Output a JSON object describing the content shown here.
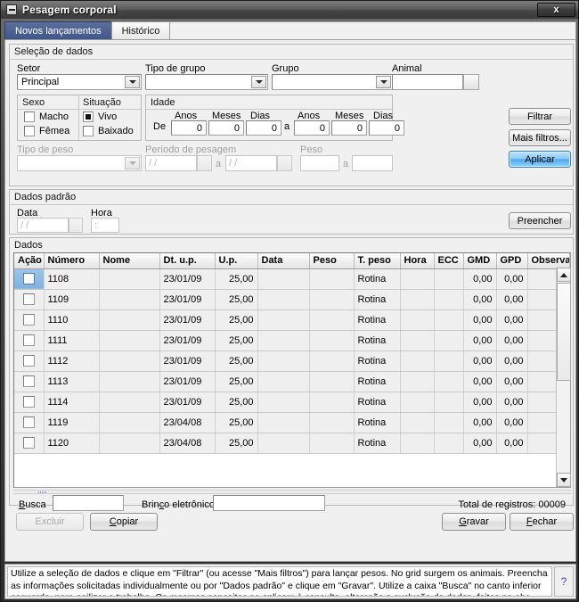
{
  "window": {
    "title": "Pesagem corporal",
    "sysmenu_icon": "minimize-box-icon",
    "close_label": "x"
  },
  "tabs": [
    {
      "label": "Novos lançamentos",
      "active": true
    },
    {
      "label": "Histórico",
      "active": false
    }
  ],
  "selection": {
    "group_label": "Seleção de dados",
    "setor": {
      "label": "Setor",
      "value": "Principal"
    },
    "tipo_de_grupo": {
      "label": "Tipo de grupo",
      "value": ""
    },
    "grupo": {
      "label": "Grupo",
      "value": ""
    },
    "animal": {
      "label": "Animal",
      "value": ""
    },
    "sexo": {
      "label": "Sexo",
      "options": [
        {
          "label": "Macho",
          "checked": false
        },
        {
          "label": "Fêmea",
          "checked": false
        }
      ]
    },
    "situacao": {
      "label": "Situação",
      "options": [
        {
          "label": "Vivo",
          "checked": true
        },
        {
          "label": "Baixado",
          "checked": false
        }
      ]
    },
    "idade": {
      "label": "Idade",
      "from_label": "De",
      "to_label": "a",
      "col_labels": [
        "Anos",
        "Meses",
        "Dias"
      ],
      "from_values": [
        "0",
        "0",
        "0"
      ],
      "to_values": [
        "0",
        "0",
        "0"
      ]
    },
    "tipo_de_peso": {
      "label": "Tipo de peso",
      "value": "",
      "disabled": true
    },
    "periodo_de_pesagem": {
      "label": "Período de pesagem",
      "from_value": "/  /",
      "to_label": "a",
      "to_value": "/  /",
      "disabled": true
    },
    "peso": {
      "label": "Peso",
      "from_value": "",
      "to_label": "a",
      "to_value": "",
      "disabled": true
    },
    "buttons": {
      "filtrar": "Filtrar",
      "mais_filtros": "Mais filtros...",
      "aplicar": "Aplicar"
    }
  },
  "defaults": {
    "group_label": "Dados padrão",
    "data": {
      "label": "Data",
      "value": "/  /"
    },
    "hora": {
      "label": "Hora",
      "value": ":"
    },
    "preencher": "Preencher"
  },
  "grid": {
    "group_label": "Dados",
    "columns": [
      "Ação",
      "Número",
      "Nome",
      "Dt. u.p.",
      "U.p.",
      "Data",
      "Peso",
      "T. peso",
      "Hora",
      "ECC",
      "GMD",
      "GPD",
      "Observação"
    ],
    "rows": [
      {
        "selected": true,
        "acao": "",
        "numero": "1108",
        "nome": "",
        "dt_up": "23/01/09",
        "up": "25,00",
        "data": "",
        "peso": "",
        "t_peso": "Rotina",
        "hora": "",
        "ecc": "",
        "gmd": "0,00",
        "gpd": "0,00",
        "observacao": ""
      },
      {
        "selected": false,
        "acao": "",
        "numero": "1109",
        "nome": "",
        "dt_up": "23/01/09",
        "up": "25,00",
        "data": "",
        "peso": "",
        "t_peso": "Rotina",
        "hora": "",
        "ecc": "",
        "gmd": "0,00",
        "gpd": "0,00",
        "observacao": ""
      },
      {
        "selected": false,
        "acao": "",
        "numero": "1110",
        "nome": "",
        "dt_up": "23/01/09",
        "up": "25,00",
        "data": "",
        "peso": "",
        "t_peso": "Rotina",
        "hora": "",
        "ecc": "",
        "gmd": "0,00",
        "gpd": "0,00",
        "observacao": ""
      },
      {
        "selected": false,
        "acao": "",
        "numero": "1111",
        "nome": "",
        "dt_up": "23/01/09",
        "up": "25,00",
        "data": "",
        "peso": "",
        "t_peso": "Rotina",
        "hora": "",
        "ecc": "",
        "gmd": "0,00",
        "gpd": "0,00",
        "observacao": ""
      },
      {
        "selected": false,
        "acao": "",
        "numero": "1112",
        "nome": "",
        "dt_up": "23/01/09",
        "up": "25,00",
        "data": "",
        "peso": "",
        "t_peso": "Rotina",
        "hora": "",
        "ecc": "",
        "gmd": "0,00",
        "gpd": "0,00",
        "observacao": ""
      },
      {
        "selected": false,
        "acao": "",
        "numero": "1113",
        "nome": "",
        "dt_up": "23/01/09",
        "up": "25,00",
        "data": "",
        "peso": "",
        "t_peso": "Rotina",
        "hora": "",
        "ecc": "",
        "gmd": "0,00",
        "gpd": "0,00",
        "observacao": ""
      },
      {
        "selected": false,
        "acao": "",
        "numero": "1114",
        "nome": "",
        "dt_up": "23/01/09",
        "up": "25,00",
        "data": "",
        "peso": "",
        "t_peso": "Rotina",
        "hora": "",
        "ecc": "",
        "gmd": "0,00",
        "gpd": "0,00",
        "observacao": ""
      },
      {
        "selected": false,
        "acao": "",
        "numero": "1119",
        "nome": "",
        "dt_up": "23/04/08",
        "up": "25,00",
        "data": "",
        "peso": "",
        "t_peso": "Rotina",
        "hora": "",
        "ecc": "",
        "gmd": "0,00",
        "gpd": "0,00",
        "observacao": ""
      },
      {
        "selected": false,
        "acao": "",
        "numero": "1120",
        "nome": "",
        "dt_up": "23/04/08",
        "up": "25,00",
        "data": "",
        "peso": "",
        "t_peso": "Rotina",
        "hora": "",
        "ecc": "",
        "gmd": "0,00",
        "gpd": "0,00",
        "observacao": ""
      }
    ]
  },
  "footer": {
    "busca": {
      "label": "Busca",
      "value": ""
    },
    "brinco": {
      "label": "Brinco eletrônico",
      "value": ""
    },
    "total": "Total de registros: 00009",
    "excluir": "Excluir",
    "copiar": "Copiar",
    "gravar": "Gravar",
    "fechar": "Fechar"
  },
  "help": {
    "text": "Utilize a seleção de dados e clique em \"Filtrar\" (ou acesse \"Mais filtros\") para lançar pesos. No grid surgem os animais. Preencha as informações solicitadas individualmente ou por \"Dados padrão\" e clique em  \"Gravar\". Utilize a caixa \"Busca\" no canto inferior esquerdo, para agilizar o trabalho. Os mesmos conceitos se aplicam à consulta, alteração e exclusão de dados, feitas na aba",
    "help_icon": "question-mark-icon"
  },
  "colors": {
    "accent": "#3f5488",
    "primary_button": "#4fa9ef",
    "editable_cell": "#e2f0e0"
  }
}
